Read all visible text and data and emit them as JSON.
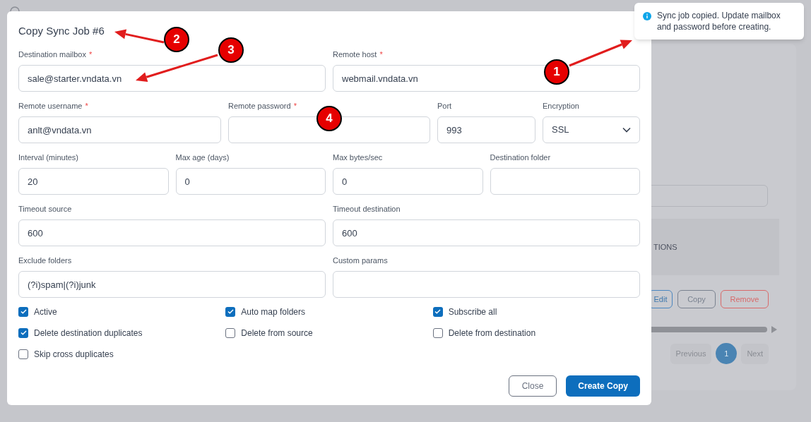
{
  "background": {
    "column_header": "TIONS",
    "row_actions": [
      {
        "label": "Edit",
        "kind": "edit"
      },
      {
        "label": "Copy",
        "kind": "copy"
      },
      {
        "label": "Remove",
        "kind": "remove"
      }
    ],
    "pagination": {
      "previous": "Previous",
      "pages": [
        {
          "label": "1",
          "selected": true
        }
      ],
      "next": "Next"
    }
  },
  "dialog": {
    "title": "Copy Sync Job #6",
    "form_rows": [
      {
        "fields": [
          {
            "label": "Destination mailbox",
            "required_mark": "*",
            "kind": "text",
            "value": "sale@starter.vndata.vn"
          },
          {
            "label": "Remote host",
            "required_mark": "*",
            "kind": "text",
            "value": "webmail.vndata.vn"
          }
        ]
      },
      {
        "fields": [
          {
            "label": "Remote username",
            "required_mark": "*",
            "kind": "text",
            "value": "anlt@vndata.vn"
          },
          {
            "label": "Remote password",
            "required_mark": "*",
            "kind": "password"
          },
          {
            "label": "Port",
            "kind": "text",
            "value": "993"
          },
          {
            "label": "Encryption",
            "kind": "select",
            "value": "SSL"
          }
        ]
      },
      {
        "fields": [
          {
            "label": "Interval (minutes)",
            "kind": "text",
            "value": "20"
          },
          {
            "label": "Max age (days)",
            "kind": "text",
            "value": "0"
          },
          {
            "label": "Max bytes/sec",
            "kind": "text",
            "value": "0"
          },
          {
            "label": "Destination folder",
            "kind": "text"
          }
        ]
      },
      {
        "fields": [
          {
            "label": "Timeout source",
            "kind": "text",
            "value": "600"
          },
          {
            "label": "Timeout destination",
            "kind": "text",
            "value": "600"
          }
        ]
      },
      {
        "fields": [
          {
            "label": "Exclude folders",
            "kind": "text",
            "value": "(?i)spam|(?i)junk"
          },
          {
            "label": "Custom params",
            "kind": "text"
          }
        ]
      }
    ],
    "checkboxes": [
      {
        "label": "Active",
        "checked": true
      },
      {
        "label": "Auto map folders",
        "checked": true
      },
      {
        "label": "Subscribe all",
        "checked": true
      },
      {
        "label": "Delete destination duplicates",
        "checked": true
      },
      {
        "label": "Delete from source",
        "checked": false
      },
      {
        "label": "Delete from destination",
        "checked": false
      },
      {
        "label": "Skip cross duplicates",
        "checked": false
      }
    ],
    "buttons": [
      {
        "label": "Close",
        "kind": "secondary"
      },
      {
        "label": "Create Copy",
        "kind": "primary"
      }
    ]
  },
  "toast": {
    "message": "Sync job copied. Update mailbox and password before creating."
  },
  "annotations": [
    {
      "number": "1"
    },
    {
      "number": "2"
    },
    {
      "number": "3"
    },
    {
      "number": "4"
    }
  ]
}
